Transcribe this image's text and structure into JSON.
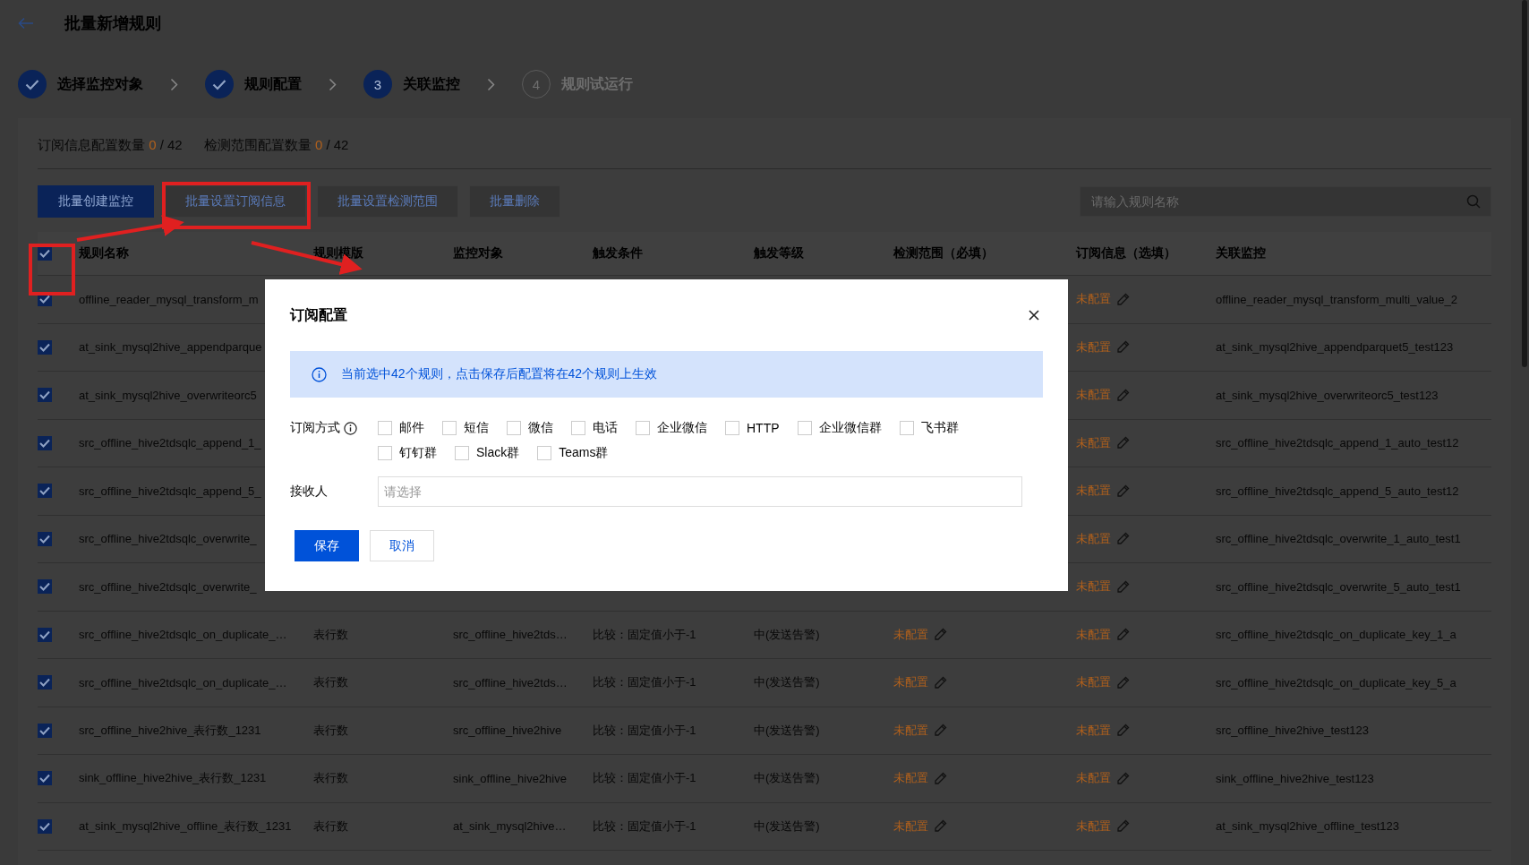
{
  "header": {
    "title": "批量新增规则"
  },
  "steps": [
    {
      "label": "选择监控对象",
      "kind": "done"
    },
    {
      "label": "规则配置",
      "kind": "done"
    },
    {
      "number": "3",
      "label": "关联监控",
      "kind": "current"
    },
    {
      "number": "4",
      "label": "规则试运行",
      "kind": "pending"
    }
  ],
  "summary": [
    {
      "label": "订阅信息配置数量",
      "configured": "0",
      "total": "/ 42"
    },
    {
      "label": "检测范围配置数量",
      "configured": "0",
      "total": "/ 42"
    }
  ],
  "toolbar": {
    "buttons": [
      {
        "label": "批量创建监控",
        "kind": "primary"
      },
      {
        "label": "批量设置订阅信息",
        "kind": "default"
      },
      {
        "label": "批量设置检测范围",
        "kind": "default"
      },
      {
        "label": "批量删除",
        "kind": "default"
      }
    ],
    "search": {
      "placeholder": "请输入规则名称"
    }
  },
  "table": {
    "all_checked": true,
    "columns": [
      "规则名称",
      "规则模版",
      "监控对象",
      "触发条件",
      "触发等级",
      "检测范围（必填）",
      "订阅信息（选填）",
      "关联监控"
    ],
    "rows": [
      {
        "checked": true,
        "name": "offline_reader_mysql_transform_m",
        "subscription": "未配置",
        "linked": "offline_reader_mysql_transform_multi_value_2"
      },
      {
        "checked": true,
        "name": "at_sink_mysql2hive_appendparque",
        "subscription": "未配置",
        "linked": "at_sink_mysql2hive_appendparquet5_test123"
      },
      {
        "checked": true,
        "name": "at_sink_mysql2hive_overwriteorc5",
        "subscription": "未配置",
        "linked": "at_sink_mysql2hive_overwriteorc5_test123"
      },
      {
        "checked": true,
        "name": "src_offline_hive2tdsqlc_append_1_",
        "subscription": "未配置",
        "linked": "src_offline_hive2tdsqlc_append_1_auto_test12"
      },
      {
        "checked": true,
        "name": "src_offline_hive2tdsqlc_append_5_",
        "subscription": "未配置",
        "linked": "src_offline_hive2tdsqlc_append_5_auto_test12"
      },
      {
        "checked": true,
        "name": "src_offline_hive2tdsqlc_overwrite_",
        "subscription": "未配置",
        "linked": "src_offline_hive2tdsqlc_overwrite_1_auto_test1"
      },
      {
        "checked": true,
        "name": "src_offline_hive2tdsqlc_overwrite_",
        "subscription": "未配置",
        "linked": "src_offline_hive2tdsqlc_overwrite_5_auto_test1"
      },
      {
        "checked": true,
        "name": "src_offline_hive2tdsqlc_on_duplicate_…",
        "template": "表行数",
        "object": "src_offline_hive2tds…",
        "condition": "比较：固定值小于-1",
        "level": "中(发送告警)",
        "scope": "未配置",
        "subscription": "未配置",
        "linked": "src_offline_hive2tdsqlc_on_duplicate_key_1_a"
      },
      {
        "checked": true,
        "name": "src_offline_hive2tdsqlc_on_duplicate_…",
        "template": "表行数",
        "object": "src_offline_hive2tds…",
        "condition": "比较：固定值小于-1",
        "level": "中(发送告警)",
        "scope": "未配置",
        "subscription": "未配置",
        "linked": "src_offline_hive2tdsqlc_on_duplicate_key_5_a"
      },
      {
        "checked": true,
        "name": "src_offline_hive2hive_表行数_1231",
        "template": "表行数",
        "object": "src_offline_hive2hive",
        "condition": "比较：固定值小于-1",
        "level": "中(发送告警)",
        "scope": "未配置",
        "subscription": "未配置",
        "linked": "src_offline_hive2hive_test123"
      },
      {
        "checked": true,
        "name": "sink_offline_hive2hive_表行数_1231",
        "template": "表行数",
        "object": "sink_offline_hive2hive",
        "condition": "比较：固定值小于-1",
        "level": "中(发送告警)",
        "scope": "未配置",
        "subscription": "未配置",
        "linked": "sink_offline_hive2hive_test123"
      },
      {
        "checked": true,
        "name": "at_sink_mysql2hive_offline_表行数_1231",
        "template": "表行数",
        "object": "at_sink_mysql2hive…",
        "condition": "比较：固定值小于-1",
        "level": "中(发送告警)",
        "scope": "未配置",
        "subscription": "未配置",
        "linked": "at_sink_mysql2hive_offline_test123"
      }
    ]
  },
  "dialog": {
    "title": "订阅配置",
    "notice": "当前选中42个规则，点击保存后配置将在42个规则上生效",
    "method_label": "订阅方式",
    "methods": [
      {
        "label": "邮件",
        "checked": false
      },
      {
        "label": "短信",
        "checked": false
      },
      {
        "label": "微信",
        "checked": false
      },
      {
        "label": "电话",
        "checked": false
      },
      {
        "label": "企业微信",
        "checked": false
      },
      {
        "label": "HTTP",
        "checked": false
      },
      {
        "label": "企业微信群",
        "checked": false
      },
      {
        "label": "飞书群",
        "checked": false
      },
      {
        "label": "钉钉群",
        "checked": false
      },
      {
        "label": "Slack群",
        "checked": false
      },
      {
        "label": "Teams群",
        "checked": false
      }
    ],
    "receiver_label": "接收人",
    "receiver": {
      "placeholder": "请选择"
    },
    "buttons": [
      {
        "label": "保存",
        "kind": "primary"
      },
      {
        "label": "取消",
        "kind": "default"
      }
    ]
  }
}
